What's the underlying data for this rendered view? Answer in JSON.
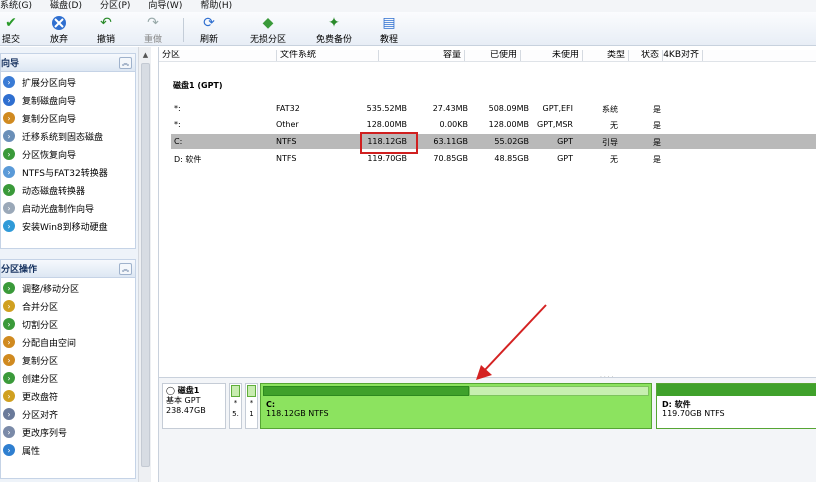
{
  "menu": [
    "系统(G)",
    "磁盘(D)",
    "分区(P)",
    "向导(W)",
    "帮助(H)"
  ],
  "toolbar": {
    "commit": "提交",
    "discard": "放弃",
    "undo": "撤销",
    "redo": "重做",
    "refresh": "刷新",
    "lossless": "无损分区",
    "backup": "免费备份",
    "tutorial": "教程"
  },
  "wizard": {
    "title": "向导",
    "items": [
      "扩展分区向导",
      "复制磁盘向导",
      "复制分区向导",
      "迁移系统到固态磁盘",
      "分区恢复向导",
      "NTFS与FAT32转换器",
      "动态磁盘转换器",
      "启动光盘制作向导",
      "安装Win8到移动硬盘"
    ]
  },
  "partition_ops": {
    "title": "分区操作",
    "items": [
      "调整/移动分区",
      "合并分区",
      "切割分区",
      "分配自由空间",
      "复制分区",
      "创建分区",
      "更改盘符",
      "分区对齐",
      "更改序列号",
      "属性"
    ]
  },
  "table": {
    "headers": [
      "分区",
      "文件系统",
      "容量",
      "已使用",
      "未使用",
      "类型",
      "状态",
      "4KB对齐"
    ],
    "disk_label": "磁盘1 (GPT)",
    "rows": [
      {
        "name": "*:",
        "fs": "FAT32",
        "cap": "535.52MB",
        "used": "27.43MB",
        "free": "508.09MB",
        "type": "GPT,EFI",
        "status": "系统",
        "align": "是"
      },
      {
        "name": "*:",
        "fs": "Other",
        "cap": "128.00MB",
        "used": "0.00KB",
        "free": "128.00MB",
        "type": "GPT,MSR",
        "status": "无",
        "align": "是"
      },
      {
        "name": "C:",
        "fs": "NTFS",
        "cap": "118.12GB",
        "used": "63.11GB",
        "free": "55.02GB",
        "type": "GPT",
        "status": "引导",
        "align": "是"
      },
      {
        "name": "D: 软件",
        "fs": "NTFS",
        "cap": "119.70GB",
        "used": "70.85GB",
        "free": "48.85GB",
        "type": "GPT",
        "status": "无",
        "align": "是"
      }
    ]
  },
  "diskmap": {
    "disk_name": "磁盘1",
    "disk_type": "基本 GPT",
    "disk_size": "238.47GB",
    "small1_top": "*",
    "small1_bottom": "5.",
    "small2_top": "*",
    "small2_bottom": "1",
    "c_name": "C:",
    "c_detail": "118.12GB NTFS",
    "c_used_fraction": 0.534,
    "d_name": "D: 软件",
    "d_detail": "119.70GB NTFS"
  }
}
